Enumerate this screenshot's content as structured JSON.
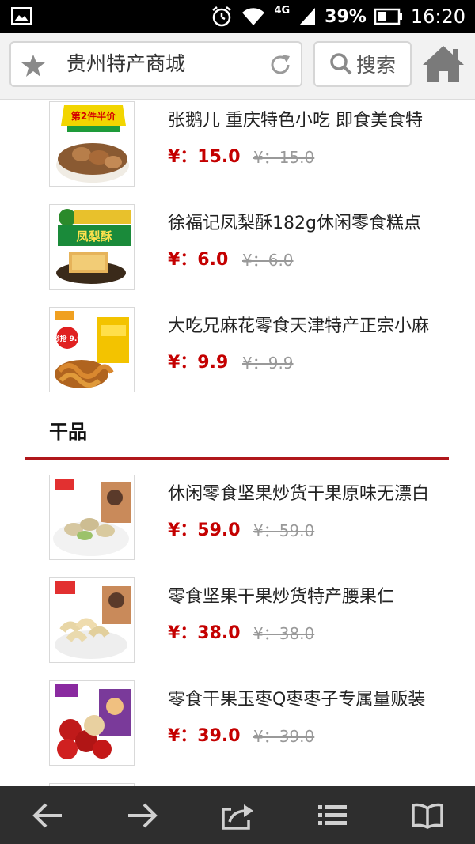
{
  "status_bar": {
    "network": "4G",
    "battery": "39%",
    "time": "16:20",
    "icons": [
      "image-icon",
      "alarm-icon",
      "wifi-icon",
      "signal-icon",
      "battery-icon"
    ]
  },
  "browser": {
    "url_title": "贵州特产商城",
    "search_label": "搜索"
  },
  "products_top": [
    {
      "title": "张鹅儿 重庆特色小吃 即食美食特",
      "price": "¥：15.0",
      "old_price": "¥：15.0",
      "thumb_badge": "第2件半价"
    },
    {
      "title": "徐福记凤梨酥182g休闲零食糕点",
      "price": "¥：6.0",
      "old_price": "¥：6.0",
      "thumb_badge": "凤梨酥"
    },
    {
      "title": "大吃兄麻花零食天津特产正宗小麻",
      "price": "¥：9.9",
      "old_price": "¥：9.9",
      "thumb_badge": "必抢 9.9"
    }
  ],
  "section": {
    "title": "干品"
  },
  "products_dry": [
    {
      "title": "休闲零食坚果炒货干果原味无漂白",
      "price": "¥：59.0",
      "old_price": "¥：59.0"
    },
    {
      "title": "零食坚果干果炒货特产腰果仁",
      "price": "¥：38.0",
      "old_price": "¥：38.0"
    },
    {
      "title": "零食干果玉枣Q枣枣子专属量贩装",
      "price": "¥：39.0",
      "old_price": "¥：39.0"
    }
  ],
  "bottom_nav": {
    "items": [
      "back-icon",
      "forward-icon",
      "share-icon",
      "menu-icon",
      "bookmarks-icon"
    ]
  },
  "colors": {
    "price_red": "#c40000",
    "section_line": "#b0171b",
    "nav_bg": "#2e2e2e"
  }
}
